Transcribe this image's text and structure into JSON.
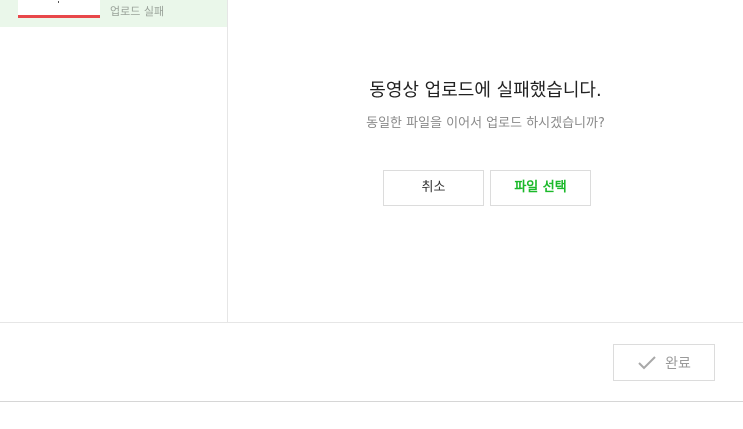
{
  "sidebar": {
    "items": [
      {
        "status": "업로드 실패"
      }
    ]
  },
  "dialog": {
    "title": "동영상 업로드에 실패했습니다.",
    "subtitle": "동일한 파일을 이어서 업로드 하시겠습니까?",
    "cancel_label": "취소",
    "select_label": "파일 선택"
  },
  "footer": {
    "done_label": "완료",
    "done_icon": "check-icon"
  },
  "colors": {
    "accent_green": "#1bb92a",
    "error_red": "#e8474a",
    "selected_bg": "#eaf7ea"
  }
}
